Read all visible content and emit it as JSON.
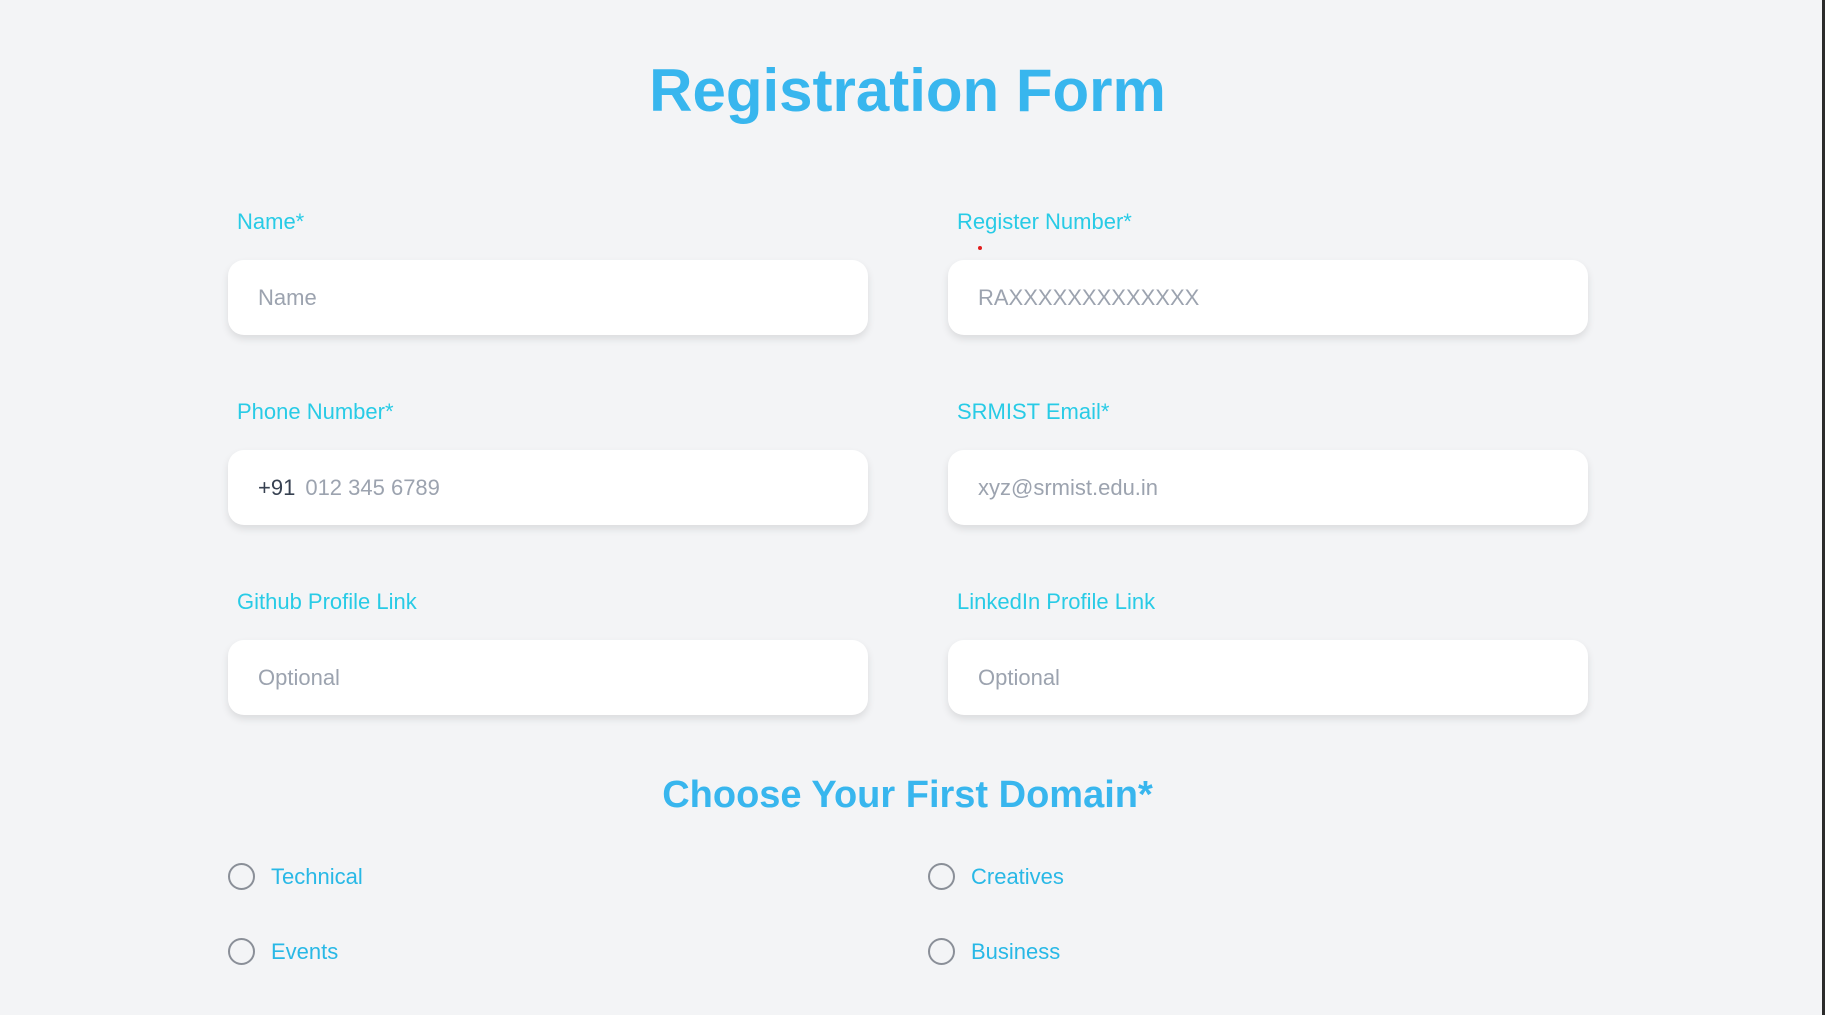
{
  "title": "Registration Form",
  "fields": {
    "name": {
      "label": "Name*",
      "placeholder": "Name"
    },
    "register_number": {
      "label": "Register Number*",
      "placeholder": "RAXXXXXXXXXXXXX"
    },
    "phone": {
      "label": "Phone Number*",
      "prefix": "+91",
      "placeholder": "012 345 6789"
    },
    "email": {
      "label": "SRMIST Email*",
      "placeholder": "xyz@srmist.edu.in"
    },
    "github": {
      "label": "Github Profile Link",
      "placeholder": "Optional"
    },
    "linkedin": {
      "label": "LinkedIn Profile Link",
      "placeholder": "Optional"
    }
  },
  "domain": {
    "title": "Choose Your First Domain*",
    "options": [
      "Technical",
      "Creatives",
      "Events",
      "Business"
    ]
  },
  "colors": {
    "title": "#38b6ee",
    "label": "#28cbe6",
    "background": "#f3f4f6"
  }
}
